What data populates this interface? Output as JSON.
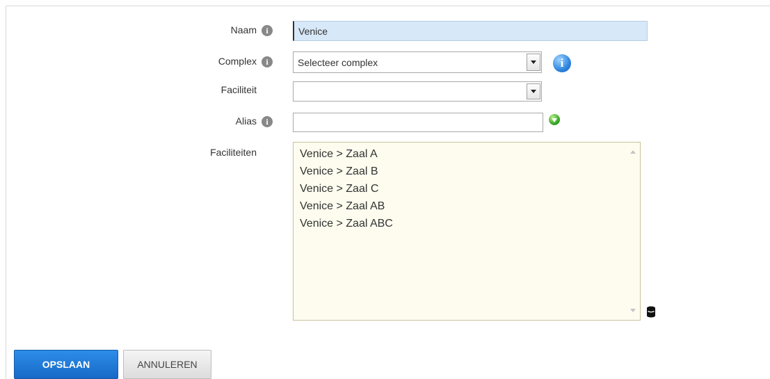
{
  "form": {
    "naam": {
      "label": "Naam",
      "value": "Venice",
      "info_icon": "info-icon"
    },
    "complex": {
      "label": "Complex",
      "selected": "Selecteer complex",
      "info_icon": "info-icon",
      "help_icon": "blue-info-icon"
    },
    "faciliteit": {
      "label": "Faciliteit",
      "selected": ""
    },
    "alias": {
      "label": "Alias",
      "value": "",
      "info_icon": "info-icon",
      "add_icon": "green-add-icon"
    },
    "faciliteiten": {
      "label": "Faciliteiten",
      "items": [
        "Venice > Zaal A",
        "Venice > Zaal B",
        "Venice > Zaal C",
        "Venice > Zaal AB",
        "Venice > Zaal ABC"
      ],
      "side_icon": "database-icon"
    }
  },
  "actions": {
    "save_label": "OPSLAAN",
    "cancel_label": "ANNULEREN"
  },
  "colors": {
    "primary_button": "#1a74d6",
    "naam_input_bg": "#d7e8f8",
    "listbox_bg": "#fdfcef"
  }
}
